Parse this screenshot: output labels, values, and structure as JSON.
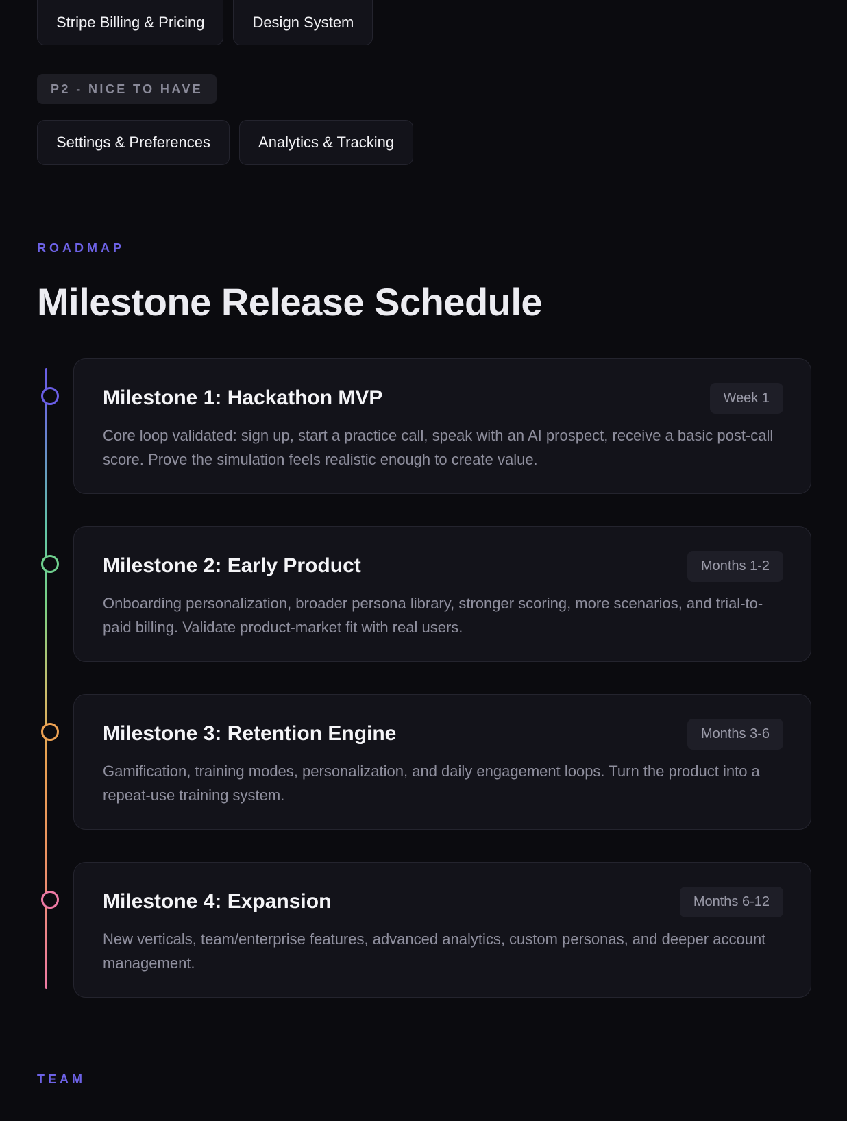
{
  "features": {
    "row1": [
      "Stripe Billing & Pricing",
      "Design System"
    ],
    "priority_label": "P2 - NICE TO HAVE",
    "row2": [
      "Settings & Preferences",
      "Analytics & Tracking"
    ]
  },
  "roadmap": {
    "eyebrow": "ROADMAP",
    "title": "Milestone Release Schedule",
    "milestones": [
      {
        "title": "Milestone 1: Hackathon MVP",
        "badge": "Week 1",
        "description": "Core loop validated: sign up, start a practice call, speak with an AI prospect, receive a basic post-call score. Prove the simulation feels realistic enough to create value.",
        "color": "#6a5ee6"
      },
      {
        "title": "Milestone 2: Early Product",
        "badge": "Months 1-2",
        "description": "Onboarding personalization, broader persona library, stronger scoring, more scenarios, and trial-to-paid billing. Validate product-market fit with real users.",
        "color": "#6fd08e"
      },
      {
        "title": "Milestone 3: Retention Engine",
        "badge": "Months 3-6",
        "description": "Gamification, training modes, personalization, and daily engagement loops. Turn the product into a repeat-use training system.",
        "color": "#eea253"
      },
      {
        "title": "Milestone 4: Expansion",
        "badge": "Months 6-12",
        "description": "New verticals, team/enterprise features, advanced analytics, custom personas, and deeper account management.",
        "color": "#ee7aa4"
      }
    ]
  },
  "team": {
    "eyebrow": "TEAM"
  }
}
